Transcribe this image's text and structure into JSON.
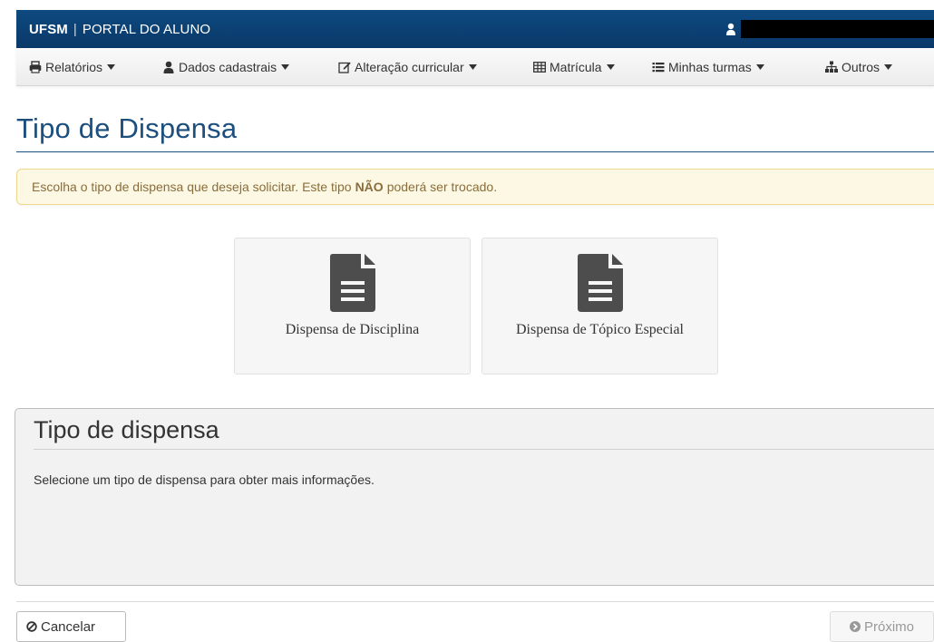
{
  "header": {
    "brand_strong": "UFSM",
    "brand_sep": "|",
    "brand_rest": "PORTAL DO ALUNO",
    "bar_color": "#0a3868",
    "user_menu_icon": "user-icon"
  },
  "nav": {
    "items": [
      {
        "label": "Relatórios",
        "icon": "print-icon"
      },
      {
        "label": "Dados cadastrais",
        "icon": "user-icon"
      },
      {
        "label": "Alteração curricular",
        "icon": "edit-icon"
      },
      {
        "label": "Matrícula",
        "icon": "table-icon"
      },
      {
        "label": "Minhas turmas",
        "icon": "list-icon"
      },
      {
        "label": "Outros",
        "icon": "sitemap-icon"
      }
    ]
  },
  "page": {
    "title": "Tipo de Dispensa",
    "title_color": "#1c4f7d"
  },
  "alert": {
    "text_before": "Escolha o tipo de dispensa que deseja solicitar. Este tipo",
    "text_strong": "NÃO",
    "text_after": "poderá ser trocado."
  },
  "options": [
    {
      "label": "Dispensa de Disciplina",
      "icon": "file-text-icon"
    },
    {
      "label": "Dispensa de Tópico Especial",
      "icon": "file-text-icon"
    }
  ],
  "info_panel": {
    "title": "Tipo de dispensa",
    "text": "Selecione um tipo de dispensa para obter mais informações."
  },
  "actions": {
    "cancel_label": "Cancelar",
    "next_label": "Próximo"
  }
}
